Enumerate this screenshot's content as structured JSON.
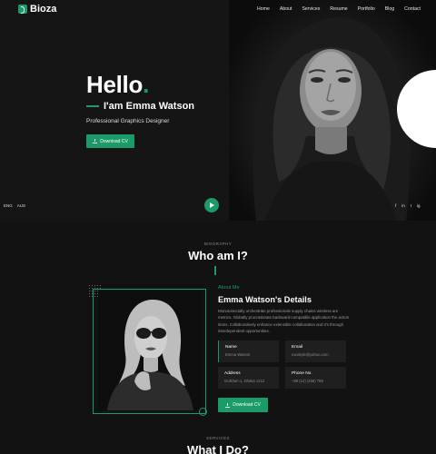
{
  "brand": {
    "name": "Bioza",
    "accent": "#1a9b67"
  },
  "nav": {
    "items": [
      "Home",
      "About",
      "Services",
      "Resume",
      "Portfolio",
      "Blog",
      "Contact"
    ]
  },
  "hero": {
    "greeting": "Hello",
    "greeting_dot": ".",
    "name": "I'am Emma Watson",
    "role": "Professional Graphics Designer",
    "button_label": "Download CV",
    "languages": [
      "ENG",
      "AUS"
    ],
    "socials": [
      "f",
      "in",
      "t",
      "ig"
    ]
  },
  "biography": {
    "kicker": "BIOGRAPHY",
    "title": "Who am I?",
    "about_label": "About Me",
    "details_title": "Emma Watson's Details",
    "text": "Monotonectally orchestrate professionals supply chains wireless are metrics. Globally procrastinate backward-compatible application the action items. Collaboratively enhance extensible collaboration and it's through interdependent opportunities.",
    "info": [
      {
        "label": "Name",
        "value": "Emma Watson"
      },
      {
        "label": "Email",
        "value": "example@yahoo.com"
      },
      {
        "label": "Address",
        "value": "Gulshan-1, Dhaka 1212"
      },
      {
        "label": "Phone No.",
        "value": "+88 (12) (456) 789"
      }
    ],
    "button_label": "Download CV"
  },
  "services": {
    "kicker": "SERVICES",
    "title": "What I Do?"
  }
}
